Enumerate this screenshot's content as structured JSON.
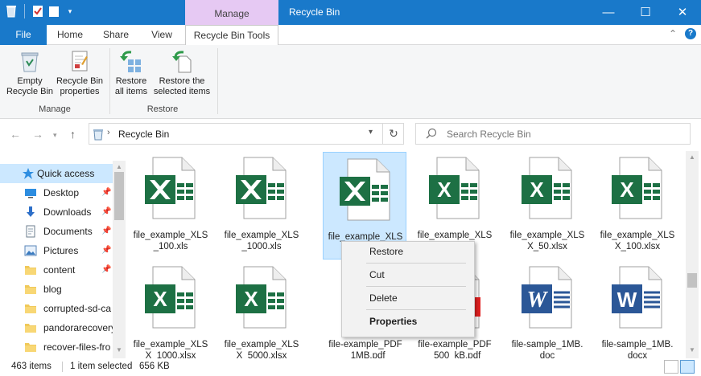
{
  "window": {
    "title": "Recycle Bin",
    "context_tab_group": "Manage",
    "controls": {
      "minimize": "—",
      "maximize": "☐",
      "close": "✕"
    }
  },
  "ribbon": {
    "tabs": [
      {
        "label": "File"
      },
      {
        "label": "Home"
      },
      {
        "label": "Share"
      },
      {
        "label": "View"
      },
      {
        "label": "Recycle Bin Tools"
      }
    ],
    "buttons": {
      "empty_line1": "Empty",
      "empty_line2": "Recycle Bin",
      "props_line1": "Recycle Bin",
      "props_line2": "properties",
      "restore_all_line1": "Restore",
      "restore_all_line2": "all items",
      "restore_sel_line1": "Restore the",
      "restore_sel_line2": "selected items"
    },
    "groups": {
      "manage": "Manage",
      "restore": "Restore"
    }
  },
  "address": {
    "path": "Recycle Bin",
    "search_placeholder": "Search Recycle Bin"
  },
  "nav_pane": {
    "items": [
      {
        "label": "Quick access",
        "icon": "star-icon",
        "pinned": false
      },
      {
        "label": "Desktop",
        "icon": "desktop-icon",
        "pinned": true
      },
      {
        "label": "Downloads",
        "icon": "download-icon",
        "pinned": true
      },
      {
        "label": "Documents",
        "icon": "documents-icon",
        "pinned": true
      },
      {
        "label": "Pictures",
        "icon": "pictures-icon",
        "pinned": true
      },
      {
        "label": "content",
        "icon": "folder-icon",
        "pinned": true
      },
      {
        "label": "blog",
        "icon": "folder-icon",
        "pinned": false
      },
      {
        "label": "corrupted-sd-ca",
        "icon": "folder-icon",
        "pinned": false
      },
      {
        "label": "pandorarecovery",
        "icon": "folder-icon",
        "pinned": false
      },
      {
        "label": "recover-files-fro",
        "icon": "folder-icon",
        "pinned": false
      }
    ],
    "pin_glyph": "📌"
  },
  "files": [
    {
      "line1": "file_example_XLS",
      "line2": "_100.xls",
      "type": "xls"
    },
    {
      "line1": "file_example_XLS",
      "line2": "_1000.xls",
      "type": "xls"
    },
    {
      "line1": "file_example_XLS",
      "line2": "",
      "type": "xls",
      "selected": true
    },
    {
      "line1": "file_example_XLS",
      "line2": "",
      "type": "xlsx"
    },
    {
      "line1": "file_example_XLS",
      "line2": "X_50.xlsx",
      "type": "xlsx"
    },
    {
      "line1": "file_example_XLS",
      "line2": "X_100.xlsx",
      "type": "xlsx"
    },
    {
      "line1": "file_example_XLS",
      "line2": "X_1000.xlsx",
      "type": "xlsx"
    },
    {
      "line1": "file_example_XLS",
      "line2": "X_5000.xlsx",
      "type": "xlsx"
    },
    {
      "line1": "file-example_PDF",
      "line2": "_1MB.pdf",
      "type": "pdf"
    },
    {
      "line1": "file-example_PDF",
      "line2": "_500_kB.pdf",
      "type": "pdf"
    },
    {
      "line1": "file-sample_1MB.",
      "line2": "doc",
      "type": "doc"
    },
    {
      "line1": "file-sample_1MB.",
      "line2": "docx",
      "type": "docx"
    }
  ],
  "context_menu": {
    "items": [
      {
        "label": "Restore"
      },
      {
        "label": "Cut"
      },
      {
        "label": "Delete"
      },
      {
        "label": "Properties"
      }
    ]
  },
  "status_bar": {
    "item_count": "463 items",
    "selection": "1 item selected",
    "size": "656 KB"
  },
  "colors": {
    "title_bar": "#1979ca",
    "context_tab": "#e6c9f3",
    "selection": "#cce8ff",
    "excel_green": "#1d7044",
    "word_blue": "#2b5797",
    "pdf_red": "#e02020"
  }
}
